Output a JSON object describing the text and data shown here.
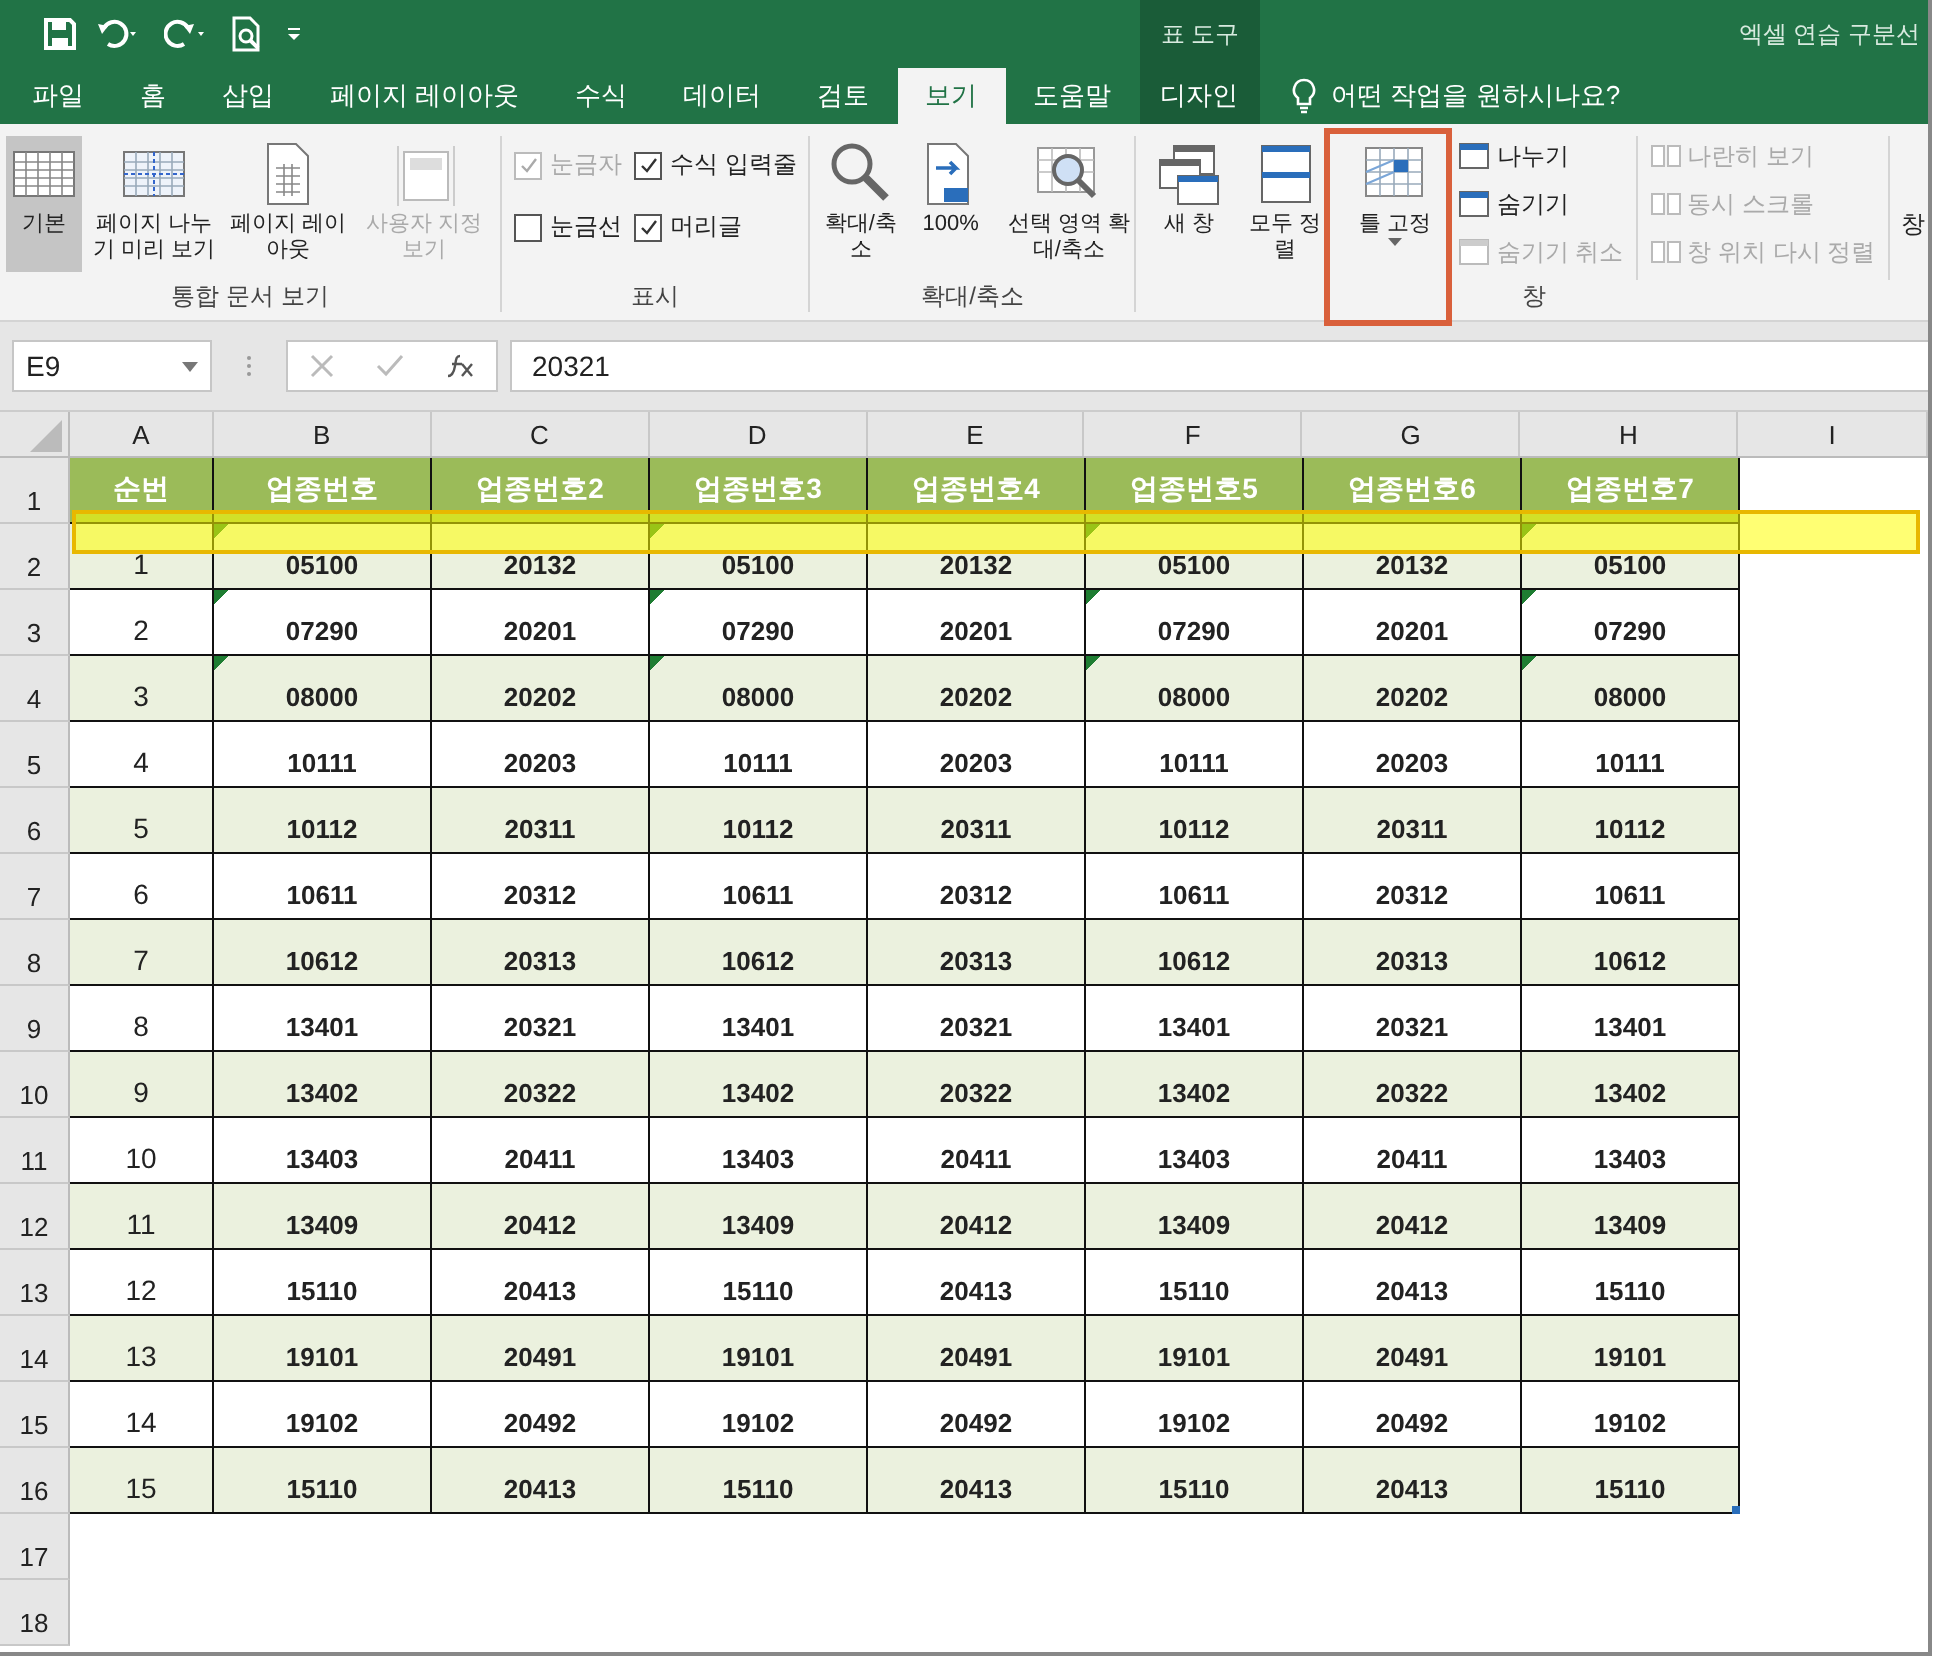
{
  "title_bar": {
    "context_tab": "표 도구",
    "doc_title": "엑셀 연습 구분선"
  },
  "tabs": [
    {
      "label": "파일",
      "selected": false
    },
    {
      "label": "홈",
      "selected": false
    },
    {
      "label": "삽입",
      "selected": false
    },
    {
      "label": "페이지 레이아웃",
      "selected": false
    },
    {
      "label": "수식",
      "selected": false
    },
    {
      "label": "데이터",
      "selected": false
    },
    {
      "label": "검토",
      "selected": false
    },
    {
      "label": "보기",
      "selected": true
    },
    {
      "label": "도움말",
      "selected": false
    },
    {
      "label": "디자인",
      "selected": false,
      "contextual": true
    }
  ],
  "tell_me": {
    "placeholder": "어떤 작업을 원하시나요?"
  },
  "ribbon": {
    "workbook_views": {
      "label": "통합 문서 보기",
      "buttons": [
        {
          "label": "기본",
          "selected": true,
          "disabled": false
        },
        {
          "label": "페이지 나누기 미리 보기",
          "selected": false,
          "disabled": false
        },
        {
          "label": "페이지 레이아웃",
          "selected": false,
          "disabled": false
        },
        {
          "label": "사용자 지정 보기",
          "selected": false,
          "disabled": true
        }
      ]
    },
    "show": {
      "label": "표시",
      "checkboxes": [
        {
          "label": "눈금자",
          "checked": true,
          "disabled": true
        },
        {
          "label": "수식 입력줄",
          "checked": true,
          "disabled": false
        },
        {
          "label": "눈금선",
          "checked": false,
          "disabled": false
        },
        {
          "label": "머리글",
          "checked": true,
          "disabled": false
        }
      ]
    },
    "zoom": {
      "label": "확대/축소",
      "buttons": [
        "확대/축소",
        "100%",
        "선택 영역 확대/축소"
      ]
    },
    "window": {
      "label": "창",
      "large_buttons": [
        "새 창",
        "모두 정렬",
        "틀 고정"
      ],
      "small_buttons": [
        {
          "label": "나누기",
          "disabled": false
        },
        {
          "label": "숨기기",
          "disabled": false
        },
        {
          "label": "숨기기 취소",
          "disabled": true
        },
        {
          "label": "나란히 보기",
          "disabled": true
        },
        {
          "label": "동시 스크롤",
          "disabled": true
        },
        {
          "label": "창 위치 다시 정렬",
          "disabled": true
        }
      ],
      "cut_label": "창"
    }
  },
  "formula_bar": {
    "name_box": "E9",
    "value": "20321"
  },
  "sheet": {
    "columns": [
      "A",
      "B",
      "C",
      "D",
      "E",
      "F",
      "G",
      "H",
      "I"
    ],
    "row_numbers": [
      "1",
      "2",
      "3",
      "4",
      "5",
      "6",
      "7",
      "8",
      "9",
      "10",
      "11",
      "12",
      "13",
      "14",
      "15",
      "16",
      "17",
      "18"
    ],
    "header": [
      "순번",
      "업종번호",
      "업종번호2",
      "업종번호3",
      "업종번호4",
      "업종번호5",
      "업종번호6",
      "업종번호7"
    ],
    "rows": [
      {
        "cells": [
          "1",
          "05100",
          "20132",
          "05100",
          "20132",
          "05100",
          "20132",
          "05100"
        ],
        "flagged": [
          false,
          true,
          false,
          true,
          false,
          true,
          false,
          true
        ]
      },
      {
        "cells": [
          "2",
          "07290",
          "20201",
          "07290",
          "20201",
          "07290",
          "20201",
          "07290"
        ],
        "flagged": [
          false,
          true,
          false,
          true,
          false,
          true,
          false,
          true
        ]
      },
      {
        "cells": [
          "3",
          "08000",
          "20202",
          "08000",
          "20202",
          "08000",
          "20202",
          "08000"
        ],
        "flagged": [
          false,
          true,
          false,
          true,
          false,
          true,
          false,
          true
        ]
      },
      {
        "cells": [
          "4",
          "10111",
          "20203",
          "10111",
          "20203",
          "10111",
          "20203",
          "10111"
        ]
      },
      {
        "cells": [
          "5",
          "10112",
          "20311",
          "10112",
          "20311",
          "10112",
          "20311",
          "10112"
        ]
      },
      {
        "cells": [
          "6",
          "10611",
          "20312",
          "10611",
          "20312",
          "10611",
          "20312",
          "10611"
        ]
      },
      {
        "cells": [
          "7",
          "10612",
          "20313",
          "10612",
          "20313",
          "10612",
          "20313",
          "10612"
        ]
      },
      {
        "cells": [
          "8",
          "13401",
          "20321",
          "13401",
          "20321",
          "13401",
          "20321",
          "13401"
        ]
      },
      {
        "cells": [
          "9",
          "13402",
          "20322",
          "13402",
          "20322",
          "13402",
          "20322",
          "13402"
        ]
      },
      {
        "cells": [
          "10",
          "13403",
          "20411",
          "13403",
          "20411",
          "13403",
          "20411",
          "13403"
        ]
      },
      {
        "cells": [
          "11",
          "13409",
          "20412",
          "13409",
          "20412",
          "13409",
          "20412",
          "13409"
        ]
      },
      {
        "cells": [
          "12",
          "15110",
          "20413",
          "15110",
          "20413",
          "15110",
          "20413",
          "15110"
        ]
      },
      {
        "cells": [
          "13",
          "19101",
          "20491",
          "19101",
          "20491",
          "19101",
          "20491",
          "19101"
        ]
      },
      {
        "cells": [
          "14",
          "19102",
          "20492",
          "19102",
          "20492",
          "19102",
          "20492",
          "19102"
        ]
      },
      {
        "cells": [
          "15",
          "15110",
          "20413",
          "15110",
          "20413",
          "15110",
          "20413",
          "15110"
        ]
      }
    ]
  }
}
